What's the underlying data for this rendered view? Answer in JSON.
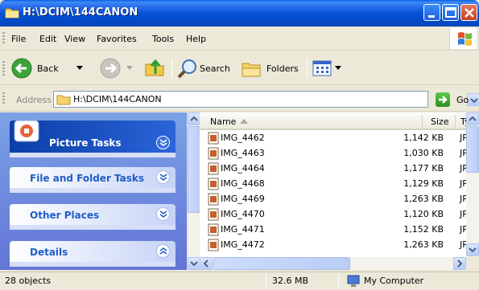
{
  "window": {
    "title": "H:\\DCIM\\144CANON"
  },
  "menu": [
    {
      "label": "File",
      "u": "F",
      "rest": "ile"
    },
    {
      "label": "Edit",
      "u": "E",
      "rest": "dit"
    },
    {
      "label": "View",
      "u": "V",
      "rest": "iew"
    },
    {
      "label": "Favorites",
      "u": "",
      "pre": "F",
      "u2": "a",
      "rest": "vorites"
    },
    {
      "label": "Tools",
      "u": "T",
      "rest": "ools"
    },
    {
      "label": "Help",
      "u": "H",
      "rest": "elp"
    }
  ],
  "toolbar": {
    "back": "Back",
    "search": "Search",
    "folders": "Folders"
  },
  "address": {
    "label": "Address",
    "value": "H:\\DCIM\\144CANON",
    "go": "Go"
  },
  "tasks": {
    "picture": "Picture Tasks",
    "file_folder": "File and Folder Tasks",
    "other_places": "Other Places",
    "details": "Details"
  },
  "columns": {
    "name": "Name",
    "size": "Size",
    "type": "Ty"
  },
  "files": [
    {
      "name": "IMG_4462",
      "size": "1,142 KB",
      "type": "JP"
    },
    {
      "name": "IMG_4463",
      "size": "1,030 KB",
      "type": "JP"
    },
    {
      "name": "IMG_4464",
      "size": "1,177 KB",
      "type": "JP"
    },
    {
      "name": "IMG_4468",
      "size": "1,129 KB",
      "type": "JP"
    },
    {
      "name": "IMG_4469",
      "size": "1,263 KB",
      "type": "JP"
    },
    {
      "name": "IMG_4470",
      "size": "1,120 KB",
      "type": "JP"
    },
    {
      "name": "IMG_4471",
      "size": "1,152 KB",
      "type": "JP"
    },
    {
      "name": "IMG_4472",
      "size": "1,263 KB",
      "type": "JP"
    }
  ],
  "status": {
    "objects": "28 objects",
    "size": "32.6 MB",
    "location": "My Computer"
  }
}
